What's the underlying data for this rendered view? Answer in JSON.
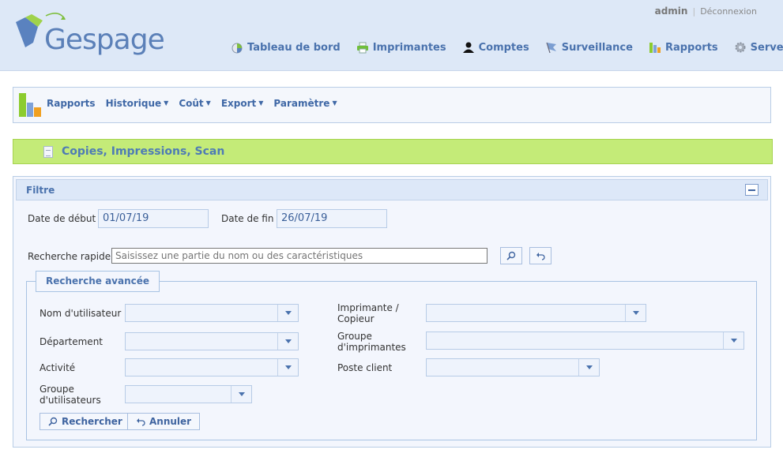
{
  "header": {
    "logo_text": "Gespage",
    "user": "admin",
    "logout": "Déconnexion",
    "nav": [
      {
        "label": "Tableau de bord",
        "icon": "dashboard-icon"
      },
      {
        "label": "Imprimantes",
        "icon": "printer-icon"
      },
      {
        "label": "Comptes",
        "icon": "user-icon"
      },
      {
        "label": "Surveillance",
        "icon": "flag-icon"
      },
      {
        "label": "Rapports",
        "icon": "chart-icon"
      },
      {
        "label": "Serveur",
        "icon": "gear-icon"
      }
    ]
  },
  "toolbar": {
    "menu": [
      {
        "label": "Rapports",
        "dropdown": false
      },
      {
        "label": "Historique",
        "dropdown": true
      },
      {
        "label": "Coût",
        "dropdown": true
      },
      {
        "label": "Export",
        "dropdown": true
      },
      {
        "label": "Paramètre",
        "dropdown": true
      }
    ]
  },
  "section": {
    "title": "Copies, Impressions, Scan"
  },
  "filter": {
    "title": "Filtre",
    "start_label": "Date de début",
    "start_value": "01/07/19",
    "end_label": "Date de fin",
    "end_value": "26/07/19",
    "quick_label": "Recherche rapide",
    "quick_placeholder": "Saisissez une partie du nom ou des caractéristiques",
    "advanced": {
      "title": "Recherche avancée",
      "user_label": "Nom d'utilisateur",
      "dept_label": "Département",
      "activity_label": "Activité",
      "usergroup_label": "Groupe d'utilisateurs",
      "printer_label": "Imprimante / Copieur",
      "printergroup_label": "Groupe d'imprimantes",
      "client_label": "Poste client",
      "search_button": "Rechercher",
      "cancel_button": "Annuler"
    }
  },
  "colors": {
    "header_bg": "#dde8f7",
    "accent": "#4a72ad",
    "section_green": "#c4eb78"
  }
}
